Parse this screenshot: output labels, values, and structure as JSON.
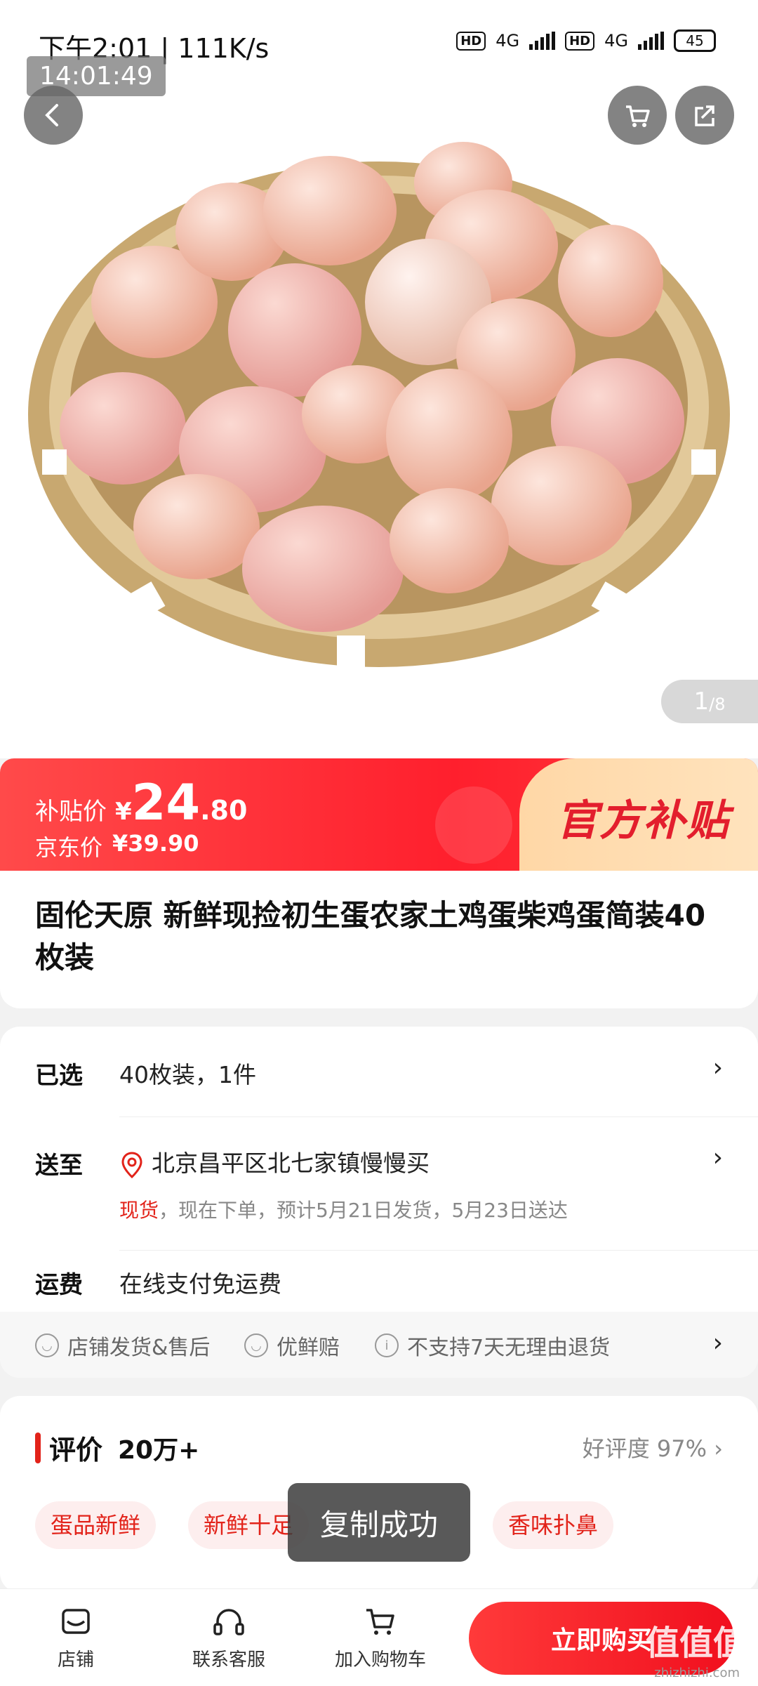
{
  "status_bar": {
    "time_speed": "下午2:01 | 111K/s",
    "network1": "4G",
    "network2": "4G",
    "hd": "HD",
    "battery": "45"
  },
  "overlay_timestamp": "14:01:49",
  "gallery": {
    "page_current": "1",
    "page_total": "/8",
    "image_name": "eggs-in-basket"
  },
  "price": {
    "subsidy_label": "补贴价",
    "currency": "¥",
    "subsidy_int": "24",
    "subsidy_dec": ".80",
    "jd_label": "京东价",
    "jd_price": "¥39.90",
    "badge": "官方补贴"
  },
  "product": {
    "title": "固伦天原 新鲜现捡初生蛋农家土鸡蛋柴鸡蛋简装40枚装"
  },
  "details": {
    "selected_label": "已选",
    "selected_value": "40枚装，1件",
    "ship_label": "送至",
    "ship_address": "北京昌平区北七家镇慢慢买",
    "stock_status": "现货",
    "delivery_text": "，现在下单，预计5月21日发货，5月23日送达",
    "freight_label": "运费",
    "freight_value": "在线支付免运费"
  },
  "services": [
    "店铺发货&售后",
    "优鲜赔",
    "不支持7天无理由退货"
  ],
  "reviews": {
    "title": "评价",
    "count": "20万+",
    "rate_label": "好评度 97%",
    "tags": [
      "蛋品新鲜",
      "新鲜十足",
      "香味扑鼻"
    ]
  },
  "toast": "复制成功",
  "bottom_bar": {
    "shop": "店铺",
    "service": "联系客服",
    "cart": "加入购物车",
    "buy": "立即购买"
  },
  "watermark": "值值值",
  "watermark_url": "zhizhizhi.com",
  "colors": {
    "accent_red": "#e2231a",
    "banner_gold": "#ffd7a6"
  }
}
